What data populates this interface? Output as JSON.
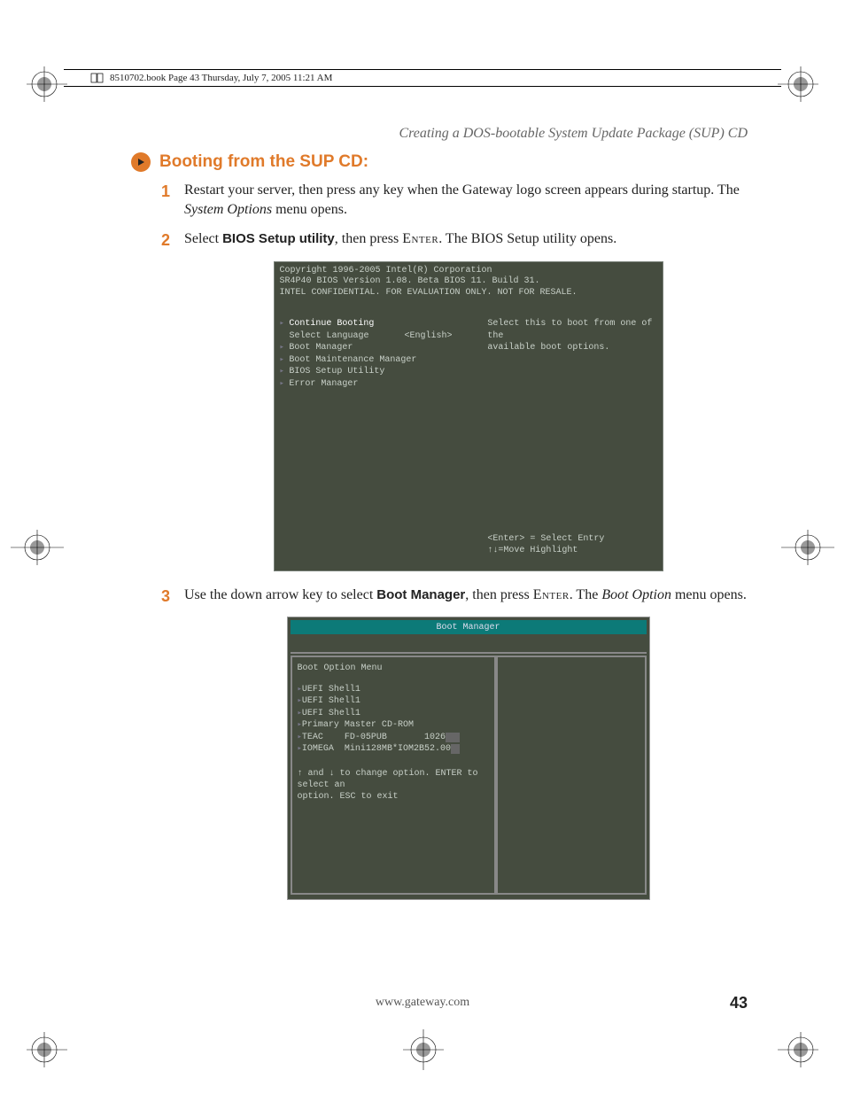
{
  "book_header": "8510702.book  Page 43  Thursday, July 7, 2005  11:21 AM",
  "running_head": "Creating a DOS-bootable System Update Package (SUP) CD",
  "section_title": "Booting from the SUP CD:",
  "steps": {
    "s1a": "Restart your server, then press any key when the Gateway logo screen appears during startup. The ",
    "s1b_i": "System Options",
    "s1c": " menu opens.",
    "s2a": "Select ",
    "s2b_b": "BIOS Setup utility",
    "s2c": ", then press ",
    "s2d_sc": "Enter",
    "s2e": ". The BIOS Setup utility opens.",
    "s3a": "Use the down arrow key to select ",
    "s3b_b": "Boot Manager",
    "s3c": ", then press ",
    "s3d_sc": "Enter",
    "s3e": ". The ",
    "s3f_i": "Boot Option",
    "s3g": " menu opens."
  },
  "shot1": {
    "h1": "Copyright 1996-2005 Intel(R) Corporation",
    "h2": "SR4P40 BIOS Version 1.08. Beta BIOS 11. Build 31.",
    "h3": "INTEL CONFIDENTIAL. FOR EVALUATION ONLY. NOT FOR RESALE.",
    "m1": "Continue Booting",
    "m2a": "Select Language",
    "m2b": "<English>",
    "m3": "Boot Manager",
    "m4": "Boot Maintenance Manager",
    "m5": "BIOS Setup Utility",
    "m6": "Error Manager",
    "help1": "Select this to boot from one of the",
    "help2": "available boot options.",
    "hint1": "<Enter> = Select Entry",
    "hint2": "↑↓=Move Highlight"
  },
  "shot2": {
    "title": "Boot Manager",
    "heading": "Boot Option Menu",
    "o1": "UEFI Shell1",
    "o2": "UEFI Shell1",
    "o3": "UEFI Shell1",
    "o4": "Primary Master CD-ROM",
    "o5a": "TEAC    FD-05PUB       1026",
    "o6": "IOMEGA  Mini128MB*IOM2B52.00",
    "hint1": "↑ and ↓ to change option. ENTER to select an",
    "hint2": "option. ESC to exit"
  },
  "footer_url": "www.gateway.com",
  "page_number": "43"
}
